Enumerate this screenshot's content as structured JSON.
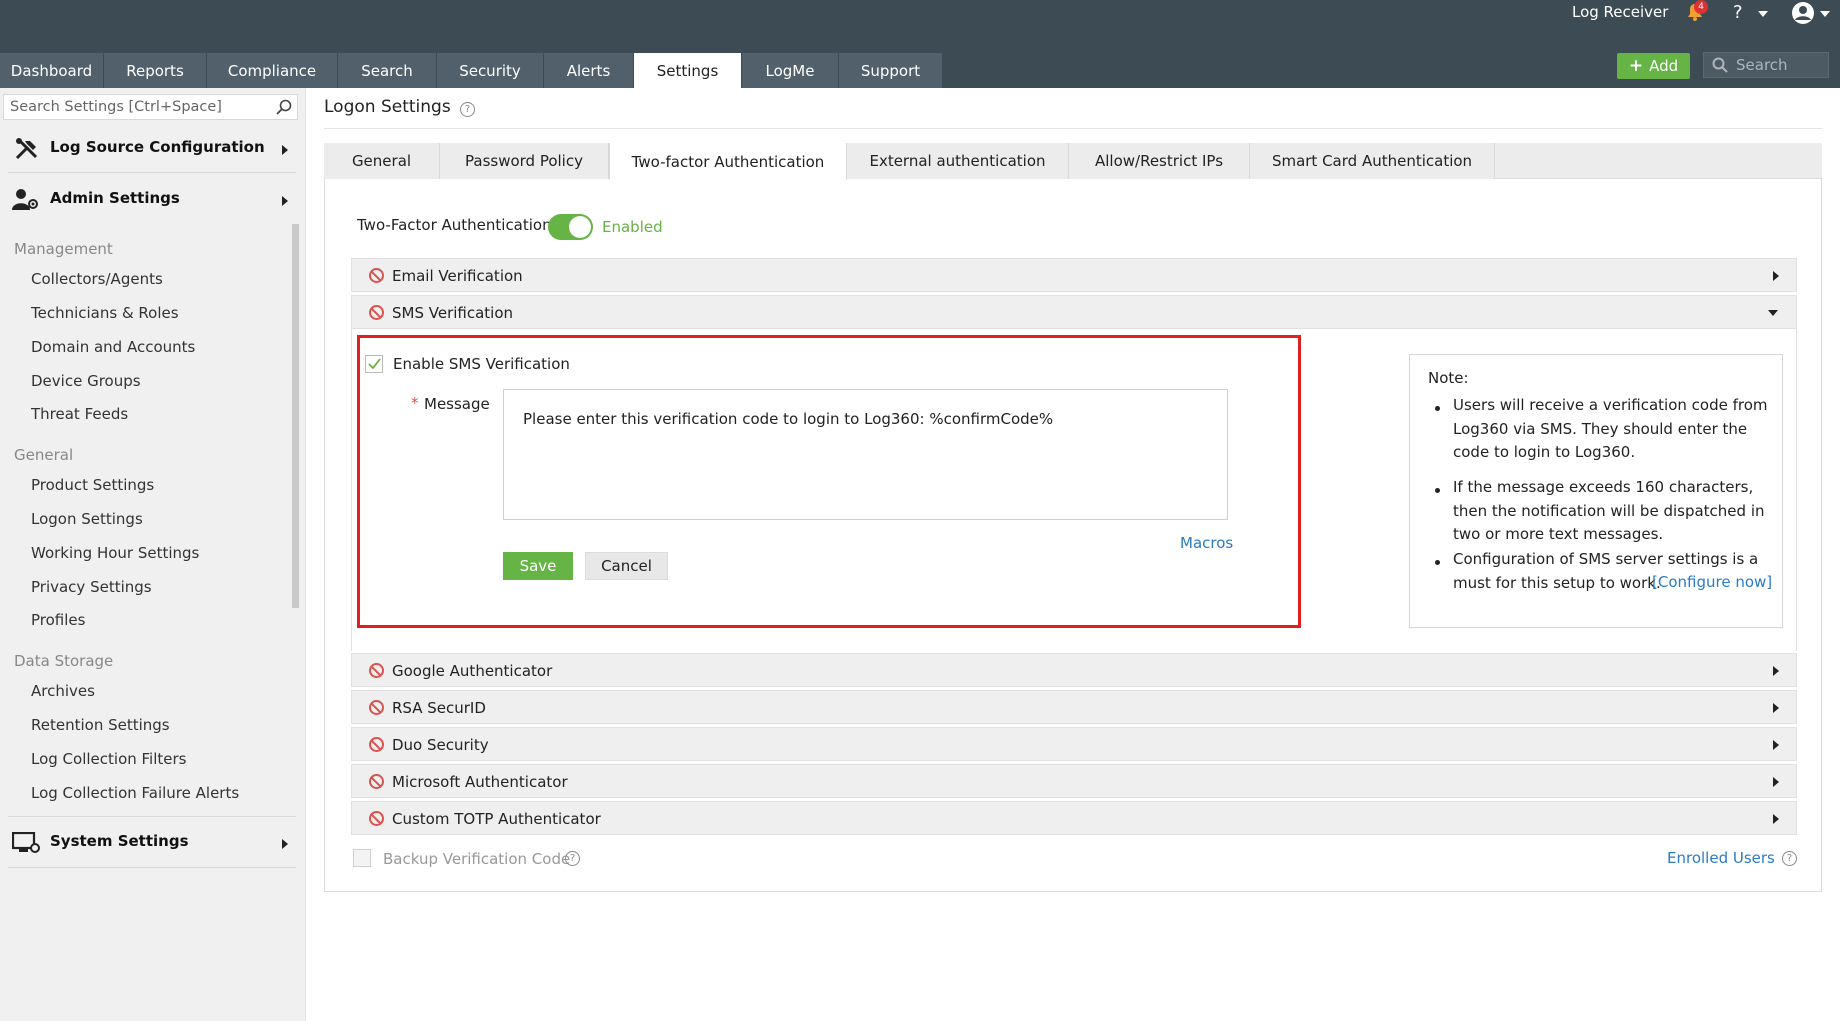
{
  "topbar": {
    "product": "Log Receiver",
    "notification_count": "4",
    "help_label": "?",
    "add_label": "Add",
    "search_placeholder": "Search",
    "nav_tabs": [
      "Dashboard",
      "Reports",
      "Compliance",
      "Search",
      "Security",
      "Alerts",
      "Settings",
      "LogMe",
      "Support"
    ],
    "active_tab": "Settings"
  },
  "sidebar": {
    "search_placeholder": "Search Settings [Ctrl+Space]",
    "sections": [
      "Log Source Configuration",
      "Admin Settings",
      "System Settings"
    ],
    "groups": {
      "management": {
        "title": "Management",
        "items": [
          "Collectors/Agents",
          "Technicians & Roles",
          "Domain and Accounts",
          "Device Groups",
          "Threat Feeds"
        ]
      },
      "general": {
        "title": "General",
        "items": [
          "Product Settings",
          "Logon Settings",
          "Working Hour Settings",
          "Privacy Settings",
          "Profiles"
        ]
      },
      "data_storage": {
        "title": "Data Storage",
        "items": [
          "Archives",
          "Retention Settings",
          "Log Collection Filters",
          "Log Collection Failure Alerts"
        ]
      }
    }
  },
  "main": {
    "title": "Logon Settings",
    "help": "?",
    "tabs": [
      "General",
      "Password Policy",
      "Two-factor Authentication",
      "External authentication",
      "Allow/Restrict IPs",
      "Smart Card Authentication"
    ],
    "active_tab": "Two-factor Authentication",
    "tfa_label": "Two-Factor Authentication",
    "tfa_status": "Enabled",
    "methods": [
      "Email Verification",
      "SMS Verification",
      "Google Authenticator",
      "RSA SecurID",
      "Duo Security",
      "Microsoft Authenticator",
      "Custom TOTP Authenticator"
    ],
    "sms": {
      "enable_label": "Enable SMS Verification",
      "required_mark": "*",
      "message_label": "Message",
      "message_value": "Please enter this verification code to login to Log360: %confirmCode%",
      "macros_link": "Macros",
      "save_label": "Save",
      "cancel_label": "Cancel"
    },
    "note": {
      "title": "Note:",
      "items": [
        "Users will receive a verification code from Log360 via SMS. They should enter the code to login to Log360.",
        "If the message exceeds 160 characters, then the notification will be dispatched in two or more text messages.",
        "Configuration of SMS server settings is a must for this setup to work."
      ],
      "configure_link": "[Configure now]"
    },
    "backup_label": "Backup Verification Code",
    "enrolled_users": "Enrolled Users"
  },
  "colors": {
    "topbar": "#3d4b55",
    "nav_tab": "#51606b",
    "accent_green": "#66b346",
    "highlight_red": "#e02020",
    "link_blue": "#2a7bc4"
  }
}
